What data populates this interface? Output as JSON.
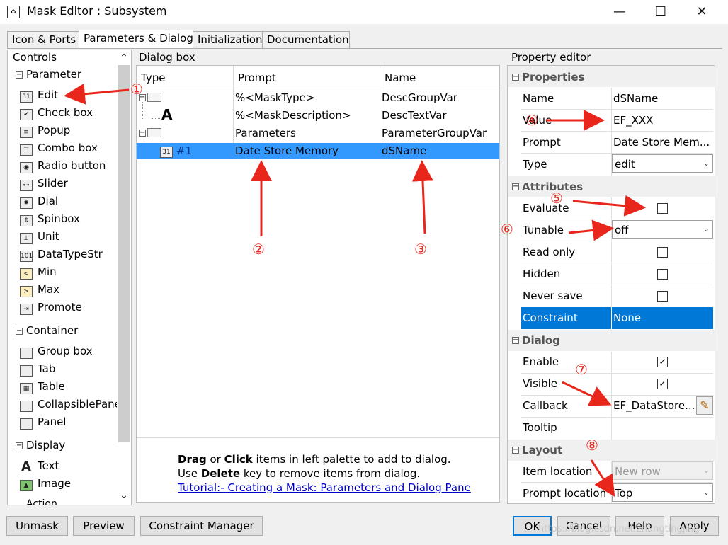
{
  "window": {
    "title": "Mask Editor : Subsystem",
    "app_icon_glyph": "⌂",
    "minimize": "—",
    "maximize": "☐",
    "close": "✕"
  },
  "tabs": [
    "Icon & Ports",
    "Parameters & Dialog",
    "Initialization",
    "Documentation"
  ],
  "controls": {
    "title": "Controls",
    "groups": [
      {
        "label": "Parameter",
        "items": [
          "Edit",
          "Check box",
          "Popup",
          "Combo box",
          "Radio button",
          "Slider",
          "Dial",
          "Spinbox",
          "Unit",
          "DataTypeStr",
          "Min",
          "Max",
          "Promote"
        ]
      },
      {
        "label": "Container",
        "items": [
          "Group box",
          "Tab",
          "Table",
          "CollapsiblePanel",
          "Panel"
        ]
      },
      {
        "label": "Display",
        "items": [
          "Text",
          "Image"
        ]
      },
      {
        "label": "Action",
        "items": []
      }
    ],
    "icons": [
      "31",
      "✔",
      "≡",
      "☰",
      "◉",
      "⊶",
      "✹",
      "⇕",
      "⊥",
      "101",
      "<",
      ">",
      "⇥",
      "",
      "",
      "▦",
      "",
      "",
      "A",
      "▲"
    ],
    "scroll_up": "⌃",
    "scroll_down": "⌄"
  },
  "dialog_box": {
    "title": "Dialog box",
    "columns": [
      "Type",
      "Prompt",
      "Name"
    ],
    "rows": [
      {
        "type": "",
        "prompt": "%<MaskType>",
        "name": "DescGroupVar"
      },
      {
        "type": "A",
        "prompt": "%<MaskDescription>",
        "name": "DescTextVar"
      },
      {
        "type": "",
        "prompt": "Parameters",
        "name": "ParameterGroupVar"
      },
      {
        "type": "#1",
        "prompt": "Date Store Memory",
        "name": "dSName",
        "selected": true
      }
    ],
    "tree_toggle": "−",
    "edit_icon": "31",
    "help": {
      "line1_bold1": "Drag",
      "line1_mid": " or ",
      "line1_bold2": "Click",
      "line1_rest": " items in left palette to add to dialog.",
      "line2_pre": "Use ",
      "line2_bold": "Delete",
      "line2_rest": " key to remove items from dialog.",
      "link": "Tutorial:- Creating a Mask: Parameters and Dialog Pane"
    }
  },
  "property_editor": {
    "title": "Property editor",
    "collapse_glyph": "−",
    "properties_label": "Properties",
    "name_label": "Name",
    "name_value": "dSName",
    "value_label": "Value",
    "value_value": "EF_XXX",
    "prompt_label": "Prompt",
    "prompt_value": "Date Store Mem...",
    "type_label": "Type",
    "type_value": "edit",
    "attributes_label": "Attributes",
    "evaluate_label": "Evaluate",
    "tunable_label": "Tunable",
    "tunable_value": "off",
    "readonly_label": "Read only",
    "hidden_label": "Hidden",
    "neversave_label": "Never save",
    "constraint_label": "Constraint",
    "constraint_value": "None",
    "dialog_label": "Dialog",
    "enable_label": "Enable",
    "visible_label": "Visible",
    "callback_label": "Callback",
    "callback_value": "EF_DataStore...",
    "tooltip_label": "Tooltip",
    "layout_label": "Layout",
    "itemloc_label": "Item location",
    "itemloc_value": "New row",
    "promptloc_label": "Prompt location",
    "promptloc_value": "Top",
    "checked_glyph": "✓",
    "edit_pencil": "✎",
    "dropdown_glyph": "⌄"
  },
  "buttons": {
    "unmask": "Unmask",
    "preview": "Preview",
    "constraint_manager": "Constraint Manager",
    "ok": "OK",
    "cancel": "Cancel",
    "help": "Help",
    "apply": "Apply"
  },
  "annotations": [
    "①",
    "②",
    "③",
    "④",
    "⑤",
    "⑥",
    "⑦",
    "⑧"
  ],
  "watermark": "https://blog.csdn.net/zhangtingjing",
  "colors": {
    "selection": "#3399ff",
    "annotation": "#e8261c"
  }
}
